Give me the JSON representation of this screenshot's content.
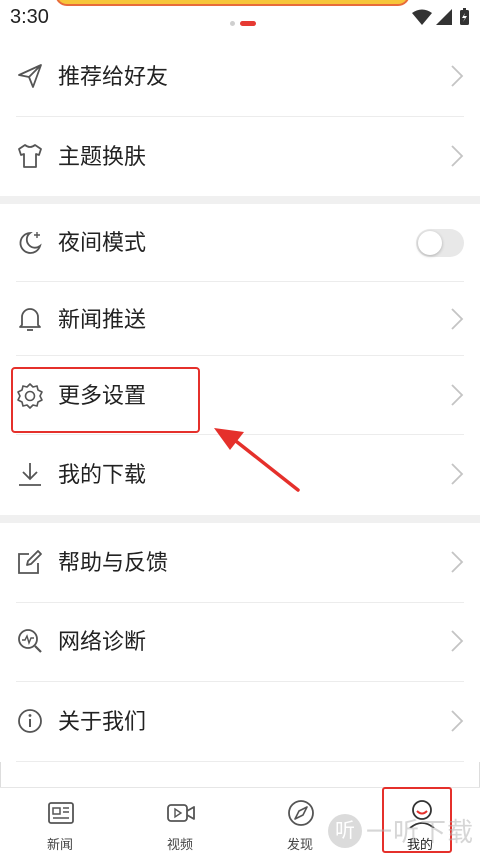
{
  "status_bar": {
    "time": "3:30"
  },
  "menu": {
    "items": [
      {
        "label": "推荐给好友",
        "icon": "send-icon"
      },
      {
        "label": "主题换肤",
        "icon": "tshirt-icon"
      },
      {
        "label": "夜间模式",
        "icon": "moon-icon",
        "toggle_on": false
      },
      {
        "label": "新闻推送",
        "icon": "bell-icon"
      },
      {
        "label": "更多设置",
        "icon": "gear-icon"
      },
      {
        "label": "我的下载",
        "icon": "download-icon"
      },
      {
        "label": "帮助与反馈",
        "icon": "edit-icon"
      },
      {
        "label": "网络诊断",
        "icon": "network-diagnose-icon"
      },
      {
        "label": "关于我们",
        "icon": "info-icon"
      }
    ]
  },
  "bottom_nav": {
    "items": [
      {
        "label": "新闻",
        "icon": "news-icon"
      },
      {
        "label": "视频",
        "icon": "video-icon"
      },
      {
        "label": "发现",
        "icon": "discover-icon"
      },
      {
        "label": "我的",
        "icon": "profile-icon",
        "active": true
      }
    ]
  },
  "watermark": {
    "badge": "听",
    "text": "一听下载"
  },
  "colors": {
    "accent_red": "#e5302b",
    "toggle_off": "#e8e8e8",
    "section_gap": "#f0f0f0"
  }
}
